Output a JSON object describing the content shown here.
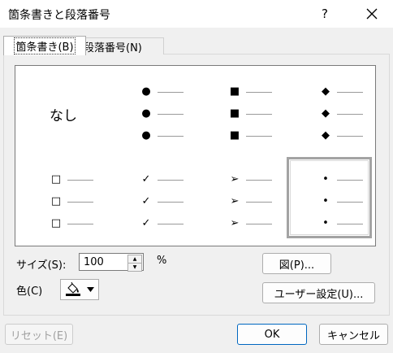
{
  "window": {
    "title": "箇条書きと段落番号",
    "help_label": "?"
  },
  "tabs": [
    {
      "label": "箇条書き(B)",
      "active": true
    },
    {
      "label": "段落番号(N)",
      "active": false
    }
  ],
  "bullet_grid": {
    "none_label": "なし",
    "cells": [
      {
        "id": "none",
        "symbol": ""
      },
      {
        "id": "filled-circle",
        "symbol": "●"
      },
      {
        "id": "filled-square",
        "symbol": "■"
      },
      {
        "id": "filled-diamond",
        "symbol": "◆"
      },
      {
        "id": "hollow-square",
        "symbol": "□"
      },
      {
        "id": "check",
        "symbol": "✓"
      },
      {
        "id": "arrow",
        "symbol": "➢"
      },
      {
        "id": "small-dot",
        "symbol": "•",
        "selected": true
      }
    ]
  },
  "size": {
    "label": "サイズ(S):",
    "value": "100",
    "unit": "%"
  },
  "color": {
    "label": "色(C)",
    "swatch": "#000000"
  },
  "buttons": {
    "picture": "図(P)...",
    "custom": "ユーザー設定(U)...",
    "reset": "リセット(E)",
    "ok": "OK",
    "cancel": "キャンセル"
  }
}
